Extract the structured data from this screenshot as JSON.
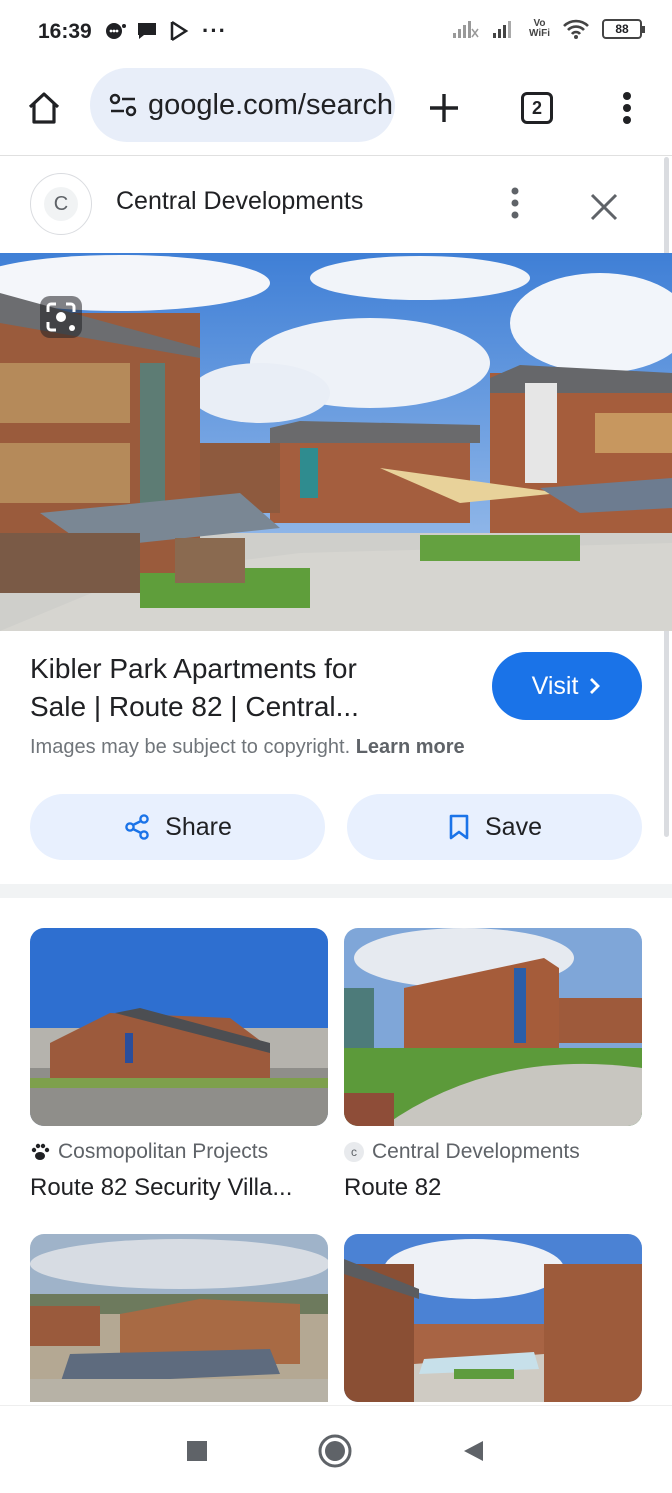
{
  "status_bar": {
    "time": "16:39",
    "ellipsis": "···",
    "vowifi_top": "Vo",
    "vowifi_bottom": "WiFi",
    "battery": "88"
  },
  "browser": {
    "url": "google.com/search",
    "tab_count": "2"
  },
  "panel": {
    "site_initial": "C",
    "site_name": "Central Developments",
    "title_line1": "Kibler Park Apartments for",
    "title_line2": "Sale | Route 82 | Central...",
    "visit_label": "Visit",
    "copyright_text": "Images may be subject to copyright.",
    "learn_more": "Learn more",
    "share_label": "Share",
    "save_label": "Save"
  },
  "related": [
    {
      "source": "Cosmopolitan Projects",
      "title": "Route 82 Security Villa..."
    },
    {
      "source": "Central Developments",
      "source_initial": "c",
      "title": "Route 82"
    }
  ],
  "colors": {
    "accent": "#1a73e8",
    "button_bg": "#e8f0fe",
    "omnibox_bg": "#e8eef9"
  }
}
